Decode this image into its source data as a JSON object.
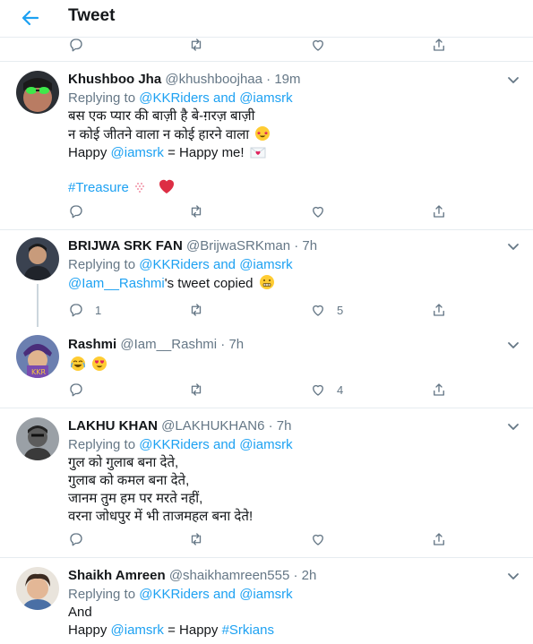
{
  "header": {
    "title": "Tweet"
  },
  "tweets": [
    {
      "name": "Khushboo Jha",
      "handle": "@khushboojhaa",
      "dot": "·",
      "time": "19m",
      "replying_prefix": "Replying to",
      "replying_to": "@KKRiders",
      "replying_and": "and",
      "replying_to_2": "@iamsrk",
      "line1": "बस एक प्यार की बाज़ी है बे-ग़रज़ बाज़ी",
      "line2": "न कोई जीतने वाला न कोई हारने वाला",
      "line3_prefix": "Happy",
      "line3_mention": "@iamsrk",
      "line3_suffix": "= Happy me!",
      "hashtag": "#Treasure",
      "actions": {
        "replies": "",
        "retweets": "",
        "likes": ""
      }
    },
    {
      "name": "BRIJWA SRK FAN",
      "handle": "@BrijwaSRKman",
      "dot": "·",
      "time": "7h",
      "replying_prefix": "Replying to",
      "replying_to": "@KKRiders",
      "replying_and": "and",
      "replying_to_2": "@iamsrk",
      "text_mention": "@Iam__Rashmi",
      "text_suffix": "'s tweet copied",
      "actions": {
        "replies": "1",
        "retweets": "",
        "likes": "5"
      }
    },
    {
      "name": "Rashmi",
      "handle": "@Iam__Rashmi",
      "dot": "·",
      "time": "7h",
      "actions": {
        "replies": "",
        "retweets": "",
        "likes": "4"
      }
    },
    {
      "name": "LAKHU KHAN",
      "handle": "@LAKHUKHAN6",
      "dot": "·",
      "time": "7h",
      "replying_prefix": "Replying to",
      "replying_to": "@KKRiders",
      "replying_and": "and",
      "replying_to_2": "@iamsrk",
      "line1": "गुल को गुलाब बना देते,",
      "line2": "गुलाब को कमल बना देते,",
      "line3": "जानम तुम हम पर मरते नहीं,",
      "line4": "वरना जोधपुर में भी ताजमहल बना देते!",
      "actions": {
        "replies": "",
        "retweets": "",
        "likes": ""
      }
    },
    {
      "name": "Shaikh Amreen",
      "handle": "@shaikhamreen555",
      "dot": "·",
      "time": "2h",
      "replying_prefix": "Replying to",
      "replying_to": "@KKRiders",
      "replying_and": "and",
      "replying_to_2": "@iamsrk",
      "line1": "And",
      "line2_prefix": "Happy",
      "line2_mention": "@iamsrk",
      "line2_mid": "= Happy",
      "line2_hashtag": "#Srkians"
    }
  ],
  "icons": {
    "back": "arrow-left-icon",
    "reply": "reply-icon",
    "retweet": "retweet-icon",
    "like": "heart-icon",
    "share": "share-icon",
    "caret": "chevron-down-icon"
  },
  "colors": {
    "accent": "#1da1f2",
    "text": "#14171a",
    "muted": "#657786",
    "border": "#e6ecf0"
  }
}
